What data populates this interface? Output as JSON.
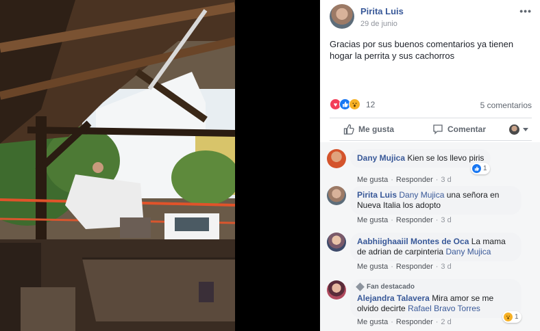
{
  "post": {
    "author": "Pirita Luis",
    "date": "29 de junio",
    "more_icon": "•••",
    "text": "Gracias por sus buenos comentarios ya tienen hogar la perrita y sus cachorros"
  },
  "reactions": {
    "icons": [
      "love-icon",
      "like-icon",
      "wow-icon"
    ],
    "count": "12",
    "comments_count": "5 comentarios"
  },
  "actions": {
    "like_label": "Me gusta",
    "comment_label": "Comentar"
  },
  "comments": [
    {
      "name": "Dany Mujica",
      "tag": "",
      "text": "Kien se los llevo piris",
      "like_label": "Me gusta",
      "reply_label": "Responder",
      "time": "3 d",
      "reaction_icon": "like-icon",
      "reaction_count": "1"
    },
    {
      "name": "Pirita Luis",
      "tag": "Dany Mujica",
      "text": "una señora en Nueva Italia los adopto",
      "like_label": "Me gusta",
      "reply_label": "Responder",
      "time": "3 d"
    },
    {
      "name": "Aabhiighaaiil Montes de Oca",
      "tag": "",
      "text": "La mama de adrian de carpinteria",
      "tag_after": "Dany Mujica",
      "like_label": "Me gusta",
      "reply_label": "Responder",
      "time": "3 d"
    },
    {
      "badge": "Fan destacado",
      "name": "Alejandra Talavera",
      "text": "Mira amor se me olvido decirte",
      "tag_after": "Rafael Bravo Torres",
      "like_label": "Me gusta",
      "reply_label": "Responder",
      "time": "2 d",
      "reaction_icon": "wow-icon",
      "reaction_count": "1"
    }
  ],
  "colors": {
    "link_blue": "#385898",
    "meta_gray": "#90949c",
    "photo_bg": "#000000"
  }
}
